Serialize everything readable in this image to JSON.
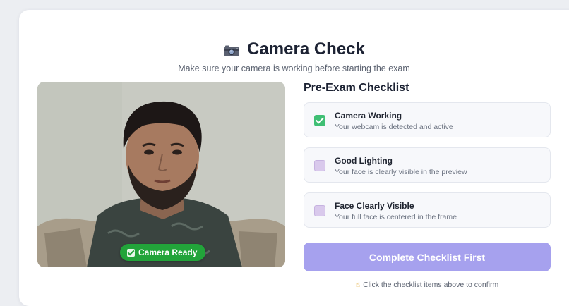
{
  "header": {
    "icon": "camera-icon",
    "title": "Camera Check",
    "subtitle": "Make sure your camera is working before starting the exam"
  },
  "preview": {
    "badge_label": "Camera Ready",
    "badge_color": "#22a43a"
  },
  "checklist": {
    "title": "Pre-Exam Checklist",
    "items": [
      {
        "label": "Camera Working",
        "description": "Your webcam is detected and active",
        "checked": true
      },
      {
        "label": "Good Lighting",
        "description": "Your face is clearly visible in the preview",
        "checked": false
      },
      {
        "label": "Face Clearly Visible",
        "description": "Your full face is centered in the frame",
        "checked": false
      }
    ]
  },
  "action": {
    "button_label": "Complete Checklist First",
    "button_color": "#a6a1ee",
    "hint_icon": "pointing-finger-icon",
    "hint": "Click the checklist items above to confirm"
  }
}
